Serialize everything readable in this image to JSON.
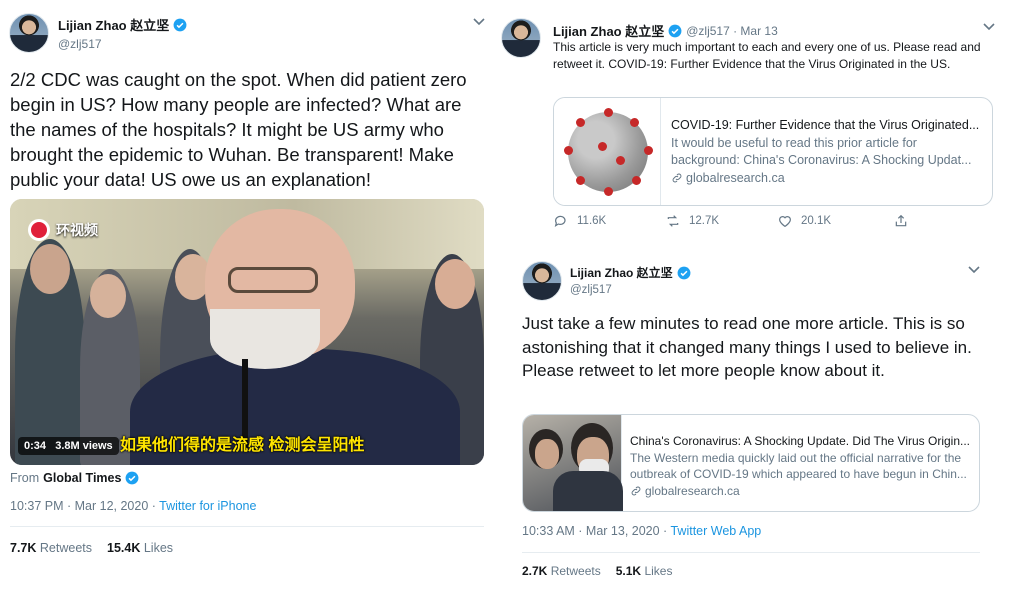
{
  "colors": {
    "link": "#1b95e0",
    "muted": "#657786",
    "text": "#14171a",
    "verified": "#1da1f2"
  },
  "tweet1": {
    "name": "Lijian Zhao 赵立坚",
    "handle": "@zlj517",
    "text": "2/2 CDC was caught on the spot. When did patient zero begin in US? How many people are infected? What are the names of the hospitals? It might be US army who brought the epidemic to Wuhan. Be transparent! Make public your data! US owe us an explanation!",
    "video": {
      "logo_text": "环视频",
      "duration": "0:34",
      "views": "3.8M views",
      "subtitle": "如果他们得的是流感 检测会呈阳性"
    },
    "from_label": "From",
    "from_account": "Global Times",
    "time": "10:37 PM · Mar 12, 2020 · ",
    "source": "Twitter for iPhone",
    "retweets_count": "7.7K",
    "retweets_label": "Retweets",
    "likes_count": "15.4K",
    "likes_label": "Likes"
  },
  "tweet2": {
    "name": "Lijian Zhao 赵立坚",
    "handle": "@zlj517 · Mar 13",
    "text": "This article is very much important to each and every one of us. Please read and retweet it. COVID-19: Further Evidence that the Virus Originated in the US.",
    "card": {
      "title": "COVID-19: Further Evidence that the Virus Originated...",
      "desc_line1": "It would be useful to read this prior article for",
      "desc_line2": "background: China's Coronavirus: A Shocking Updat...",
      "domain": "globalresearch.ca"
    },
    "replies": "11.6K",
    "retweets": "12.7K",
    "likes": "20.1K"
  },
  "tweet3": {
    "name": "Lijian Zhao 赵立坚",
    "handle": "@zlj517",
    "text": "Just take a few minutes to read one more article. This is so astonishing that it changed many things I used to believe in. Please retweet to let more people know about it.",
    "card": {
      "title": "China's Coronavirus: A Shocking Update. Did The Virus Origin...",
      "desc_line1": "The Western media quickly laid out the official narrative for the",
      "desc_line2": "outbreak of COVID-19 which appeared to have begun in Chin...",
      "domain": "globalresearch.ca"
    },
    "time": "10:33 AM · Mar 13, 2020 · ",
    "source": "Twitter Web App",
    "retweets_count": "2.7K",
    "retweets_label": "Retweets",
    "likes_count": "5.1K",
    "likes_label": "Likes"
  }
}
